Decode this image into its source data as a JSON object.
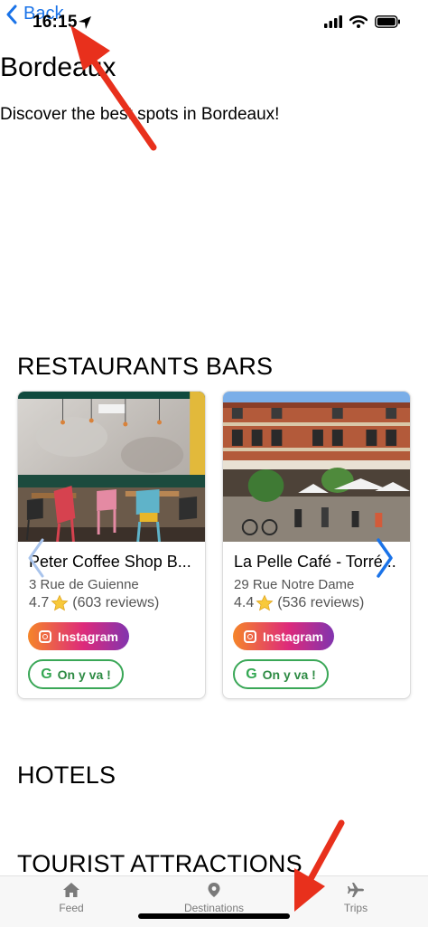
{
  "status_bar": {
    "back_label": "Back",
    "time": "16:15"
  },
  "page": {
    "title": "Bordeaux",
    "subtitle": "Discover the best spots in Bordeaux!"
  },
  "sections": {
    "restaurants_title": "RESTAURANTS BARS",
    "hotels_title": "HOTELS",
    "attractions_title": "TOURIST ATTRACTIONS"
  },
  "cards": [
    {
      "name": "Peter Coffee Shop B...",
      "address": "3 Rue de Guienne",
      "rating": "4.7",
      "reviews": "(603 reviews)",
      "instagram_label": "Instagram",
      "go_label": "On y va !"
    },
    {
      "name": "La Pelle Café - Torré...",
      "address": "29 Rue Notre Dame",
      "rating": "4.4",
      "reviews": "(536 reviews)",
      "instagram_label": "Instagram",
      "go_label": "On y va !"
    }
  ],
  "tab_bar": {
    "feed": "Feed",
    "destinations": "Destinations",
    "trips": "Trips"
  },
  "colors": {
    "accent_blue": "#1a73e8",
    "go_green": "#3aa757",
    "annotation_red": "#e8301c"
  },
  "icons": [
    "chevron-left-icon",
    "location-arrow-icon",
    "signal-icon",
    "wifi-icon",
    "battery-icon",
    "star-icon",
    "instagram-icon",
    "google-g-icon",
    "chevron-right-icon",
    "home-icon",
    "map-pin-icon",
    "airplane-icon"
  ]
}
